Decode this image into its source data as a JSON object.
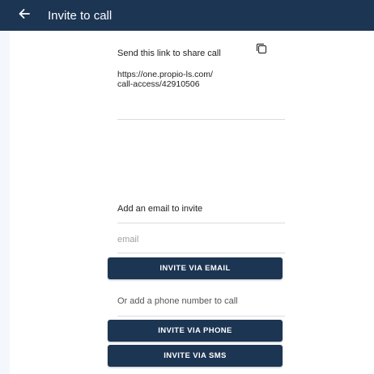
{
  "header": {
    "title": "Invite to call",
    "back_icon": "arrow-left-icon"
  },
  "share": {
    "label": "Send this link to share call",
    "link": "https://one.propio-ls.com/call-access/42910506",
    "copy_icon": "copy-icon"
  },
  "email": {
    "label": "Add an email to invite",
    "placeholder": "email",
    "value": "",
    "button_label": "INVITE VIA EMAIL"
  },
  "phone": {
    "label": "Or add a phone number to call",
    "button_phone_label": "INVITE VIA PHONE",
    "button_sms_label": "INVITE VIA SMS"
  },
  "colors": {
    "primary": "#1c3553",
    "background": "#ffffff"
  }
}
